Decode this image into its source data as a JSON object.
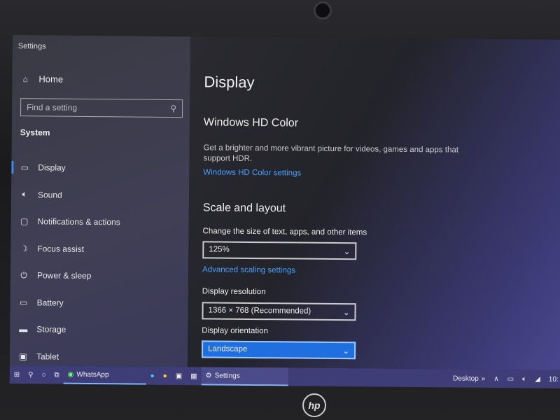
{
  "window": {
    "title": "Settings"
  },
  "sidebar": {
    "home": "Home",
    "search_placeholder": "Find a setting",
    "section": "System",
    "items": [
      {
        "label": "Display",
        "icon": "monitor-icon",
        "active": true
      },
      {
        "label": "Sound",
        "icon": "speaker-icon"
      },
      {
        "label": "Notifications & actions",
        "icon": "notification-icon"
      },
      {
        "label": "Focus assist",
        "icon": "moon-icon"
      },
      {
        "label": "Power & sleep",
        "icon": "power-icon"
      },
      {
        "label": "Battery",
        "icon": "battery-icon"
      },
      {
        "label": "Storage",
        "icon": "storage-icon"
      },
      {
        "label": "Tablet",
        "icon": "tablet-icon"
      }
    ]
  },
  "main": {
    "title": "Display",
    "hdr": {
      "heading": "Windows HD Color",
      "description": "Get a brighter and more vibrant picture for videos, games and apps that support HDR.",
      "link": "Windows HD Color settings"
    },
    "scale": {
      "heading": "Scale and layout",
      "size_label": "Change the size of text, apps, and other items",
      "size_value": "125%",
      "advanced_link": "Advanced scaling settings",
      "resolution_label": "Display resolution",
      "resolution_value": "1366 × 768 (Recommended)",
      "orientation_label": "Display orientation",
      "orientation_value": "Landscape"
    }
  },
  "taskbar": {
    "whatsapp": "WhatsApp",
    "settings": "Settings",
    "desktop": "Desktop",
    "clock": "10:"
  },
  "colors": {
    "accent": "#1f6fe0",
    "link": "#4aa0ff",
    "taskbar": "#3e3d78"
  },
  "brand": "hp"
}
